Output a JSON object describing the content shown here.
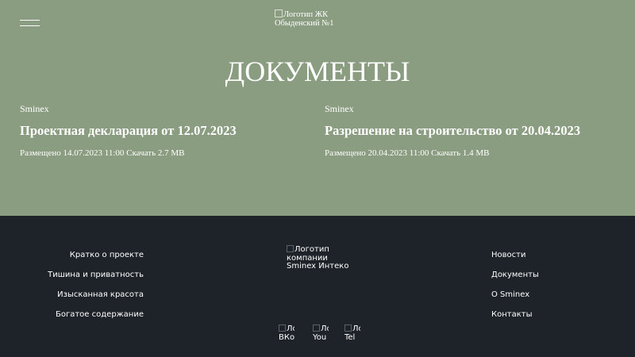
{
  "header": {
    "logo_alt_line1": "Логотип ЖК",
    "logo_alt_line2": "Обыденский №1",
    "menu_icon": "hamburger-icon"
  },
  "page": {
    "title": "ДОКУМЕНТЫ"
  },
  "documents": [
    {
      "developer": "Sminex",
      "title": "Проектная декларация от 12.07.2023",
      "meta": "Размещено 14.07.2023 11:00",
      "download": "Скачать 2.7 MB"
    },
    {
      "developer": "Sminex",
      "title": "Разрешение на строительство от 20.04.2023",
      "meta": "Размещено 20.04.2023 11:00",
      "download": "Скачать 1.4 MB"
    }
  ],
  "footer": {
    "left_nav": [
      "Кратко о проекте",
      "Тишина и приватность",
      "Изысканная красота",
      "Богатое содержание"
    ],
    "right_nav": [
      "Новости",
      "Документы",
      "О Sminex",
      "Контакты"
    ],
    "logo_alt_line1": "Логотип",
    "logo_alt_line2": "компании",
    "logo_alt_line3": "Sminex Интеко",
    "social": [
      {
        "line1": "Лого",
        "line2": "ВКо"
      },
      {
        "line1": "Лого",
        "line2": "You"
      },
      {
        "line1": "Лого",
        "line2": "Tel"
      }
    ]
  },
  "colors": {
    "hero_bg": "#8a9d80",
    "footer_bg": "#1e2329",
    "text": "#ffffff"
  }
}
